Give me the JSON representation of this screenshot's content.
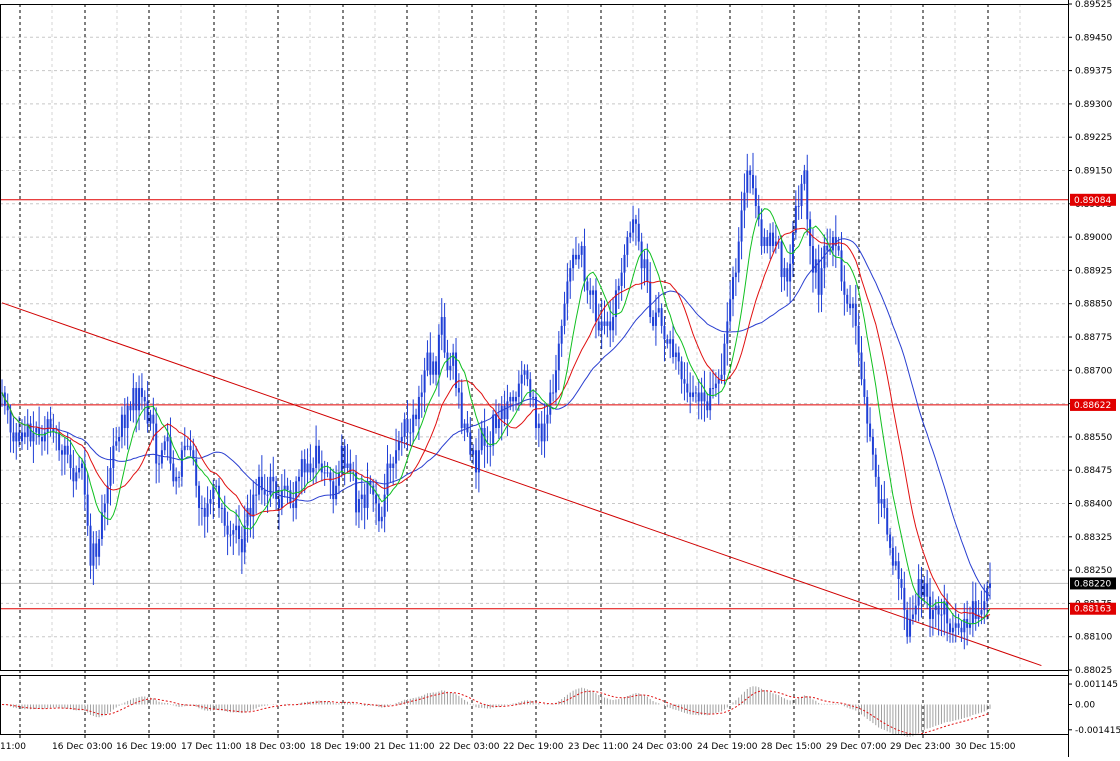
{
  "chart_data": {
    "type": "line",
    "instrument_note": "",
    "main_panel": {
      "ylim": [
        0.88025,
        0.89525
      ],
      "y_ticks": [
        "0.89525",
        "0.89450",
        "0.89375",
        "0.89300",
        "0.89225",
        "0.89150",
        "0.89075",
        "0.89000",
        "0.88925",
        "0.88850",
        "0.88775",
        "0.88700",
        "0.88625",
        "0.88550",
        "0.88475",
        "0.88400",
        "0.88325",
        "0.88250",
        "0.88175",
        "0.88100",
        "0.88025"
      ],
      "grid": true,
      "horizontal_levels": [
        {
          "value": 0.89084,
          "label": "0.89084",
          "color": "#e00000"
        },
        {
          "value": 0.88622,
          "label": "0.88622",
          "color": "#e00000"
        },
        {
          "value": 0.88163,
          "label": "0.88163",
          "color": "#e00000"
        }
      ],
      "current_price": {
        "value": 0.8822,
        "label": "0.88220"
      },
      "trendline": {
        "color": "#d00000",
        "from": {
          "bar": 0,
          "y": 0.88852
        },
        "to": {
          "bar": 364,
          "y": 0.88035
        }
      },
      "candles": {
        "color": "#1f3fd6",
        "close": [
          0.8865,
          0.8862,
          0.8861,
          0.8856,
          0.8854,
          0.8856,
          0.8854,
          0.8856,
          0.8855,
          0.8858,
          0.8854,
          0.8856,
          0.8857,
          0.8855,
          0.8854,
          0.8856,
          0.8859,
          0.8857,
          0.8856,
          0.8856,
          0.8852,
          0.8851,
          0.8853,
          0.8851,
          0.8848,
          0.8845,
          0.8847,
          0.8848,
          0.8849,
          0.8842,
          0.8835,
          0.8826,
          0.8831,
          0.8828,
          0.8832,
          0.8838,
          0.884,
          0.8844,
          0.8848,
          0.8853,
          0.8854,
          0.8855,
          0.886,
          0.8857,
          0.8862,
          0.8861,
          0.8866,
          0.8861,
          0.8866,
          0.8864,
          0.8863,
          0.8858,
          0.886,
          0.8858,
          0.8849,
          0.8849,
          0.8852,
          0.8854,
          0.8855,
          0.8849,
          0.8845,
          0.8846,
          0.8846,
          0.8852,
          0.8853,
          0.8853,
          0.8852,
          0.885,
          0.8844,
          0.8839,
          0.8839,
          0.8837,
          0.884,
          0.8841,
          0.8844,
          0.8844,
          0.8839,
          0.8839,
          0.8835,
          0.8833,
          0.8833,
          0.8834,
          0.8835,
          0.8832,
          0.8829,
          0.8835,
          0.8839,
          0.8837,
          0.8842,
          0.8842,
          0.8846,
          0.8843,
          0.8842,
          0.8842,
          0.8846,
          0.8845,
          0.8841,
          0.8839,
          0.8843,
          0.8844,
          0.8843,
          0.884,
          0.8839,
          0.8845,
          0.8846,
          0.885,
          0.8847,
          0.8849,
          0.8847,
          0.8848,
          0.8853,
          0.8849,
          0.8847,
          0.8847,
          0.8847,
          0.8845,
          0.8841,
          0.8844,
          0.8847,
          0.8853,
          0.8848,
          0.8849,
          0.8847,
          0.8847,
          0.8838,
          0.8841,
          0.8842,
          0.8839,
          0.8845,
          0.8844,
          0.8842,
          0.884,
          0.8836,
          0.8837,
          0.8842,
          0.8849,
          0.8848,
          0.8849,
          0.8852,
          0.8854,
          0.8855,
          0.8859,
          0.8856,
          0.8856,
          0.886,
          0.8859,
          0.8864,
          0.8865,
          0.887,
          0.8874,
          0.8869,
          0.8872,
          0.8869,
          0.8878,
          0.8882,
          0.8874,
          0.887,
          0.8871,
          0.8874,
          0.8866,
          0.8865,
          0.8857,
          0.8858,
          0.8856,
          0.8851,
          0.8852,
          0.8847,
          0.8852,
          0.8857,
          0.8853,
          0.8853,
          0.8853,
          0.886,
          0.8857,
          0.8859,
          0.8862,
          0.8859,
          0.8863,
          0.8864,
          0.8863,
          0.8864,
          0.8867,
          0.8869,
          0.887,
          0.8868,
          0.8864,
          0.8864,
          0.8857,
          0.8858,
          0.8854,
          0.8858,
          0.886,
          0.8865,
          0.8865,
          0.887,
          0.8876,
          0.888,
          0.8885,
          0.889,
          0.8893,
          0.8896,
          0.8895,
          0.8896,
          0.8898,
          0.889,
          0.8888,
          0.8887,
          0.8888,
          0.8881,
          0.8879,
          0.8881,
          0.888,
          0.8881,
          0.8879,
          0.8882,
          0.8888,
          0.8889,
          0.8892,
          0.8896,
          0.89,
          0.8901,
          0.8904,
          0.8903,
          0.8899,
          0.8893,
          0.8895,
          0.889,
          0.8882,
          0.888,
          0.8883,
          0.8884,
          0.888,
          0.8877,
          0.8876,
          0.8877,
          0.8873,
          0.8874,
          0.8872,
          0.8868,
          0.8867,
          0.8865,
          0.8864,
          0.8865,
          0.8865,
          0.8863,
          0.8865,
          0.8863,
          0.8861,
          0.8866,
          0.8866,
          0.8867,
          0.8868,
          0.8869,
          0.8876,
          0.8881,
          0.8886,
          0.8891,
          0.8892,
          0.8899,
          0.8906,
          0.891,
          0.8915,
          0.8914,
          0.8911,
          0.8907,
          0.8904,
          0.8898,
          0.89,
          0.8898,
          0.8901,
          0.8898,
          0.8899,
          0.8899,
          0.8891,
          0.8893,
          0.889,
          0.8894,
          0.8901,
          0.8907,
          0.8907,
          0.8912,
          0.8915,
          0.8904,
          0.8898,
          0.8892,
          0.8895,
          0.8887,
          0.8893,
          0.8898,
          0.8897,
          0.8897,
          0.89,
          0.8898,
          0.8897,
          0.889,
          0.8887,
          0.8885,
          0.8884,
          0.8885,
          0.888,
          0.8874,
          0.8868,
          0.8864,
          0.8858,
          0.8855,
          0.8851,
          0.8846,
          0.884,
          0.8841,
          0.8839,
          0.8833,
          0.883,
          0.8826,
          0.8827,
          0.8823,
          0.8821,
          0.8816,
          0.881,
          0.8814,
          0.8815,
          0.8817,
          0.8823,
          0.8819,
          0.8822,
          0.8819,
          0.8814,
          0.8816,
          0.8817,
          0.8815,
          0.8815,
          0.8818,
          0.8813,
          0.8811,
          0.8812,
          0.8813,
          0.8812,
          0.8811,
          0.8814,
          0.8812,
          0.8813,
          0.8818,
          0.8814,
          0.8815,
          0.8816,
          0.8818,
          0.8821,
          0.8822
        ],
        "note_count": 350
      },
      "ma_lines": [
        {
          "name": "",
          "color": "#2a3fd0",
          "period": 40
        },
        {
          "name": "",
          "color": "#e01010",
          "period": 20
        },
        {
          "name": "",
          "color": "#10c020",
          "period": 10
        }
      ]
    },
    "sub_panel": {
      "ylim": [
        -0.00165,
        0.00165
      ],
      "y_ticks": [
        "0.001145",
        "0.00",
        "-0.001415"
      ],
      "histogram_color": "#a0a0a0",
      "signal_color": "#e01010"
    },
    "x_axis": {
      "tick_labels": [
        "11:00",
        "16 Dec 03:00",
        "16 Dec 19:00",
        "17 Dec 11:00",
        "18 Dec 03:00",
        "18 Dec 19:00",
        "21 Dec 11:00",
        "22 Dec 03:00",
        "22 Dec 19:00",
        "23 Dec 11:00",
        "24 Dec 03:00",
        "24 Dec 19:00",
        "28 Dec 15:00",
        "29 Dec 07:00",
        "29 Dec 23:00",
        "30 Dec 15:00"
      ]
    }
  }
}
